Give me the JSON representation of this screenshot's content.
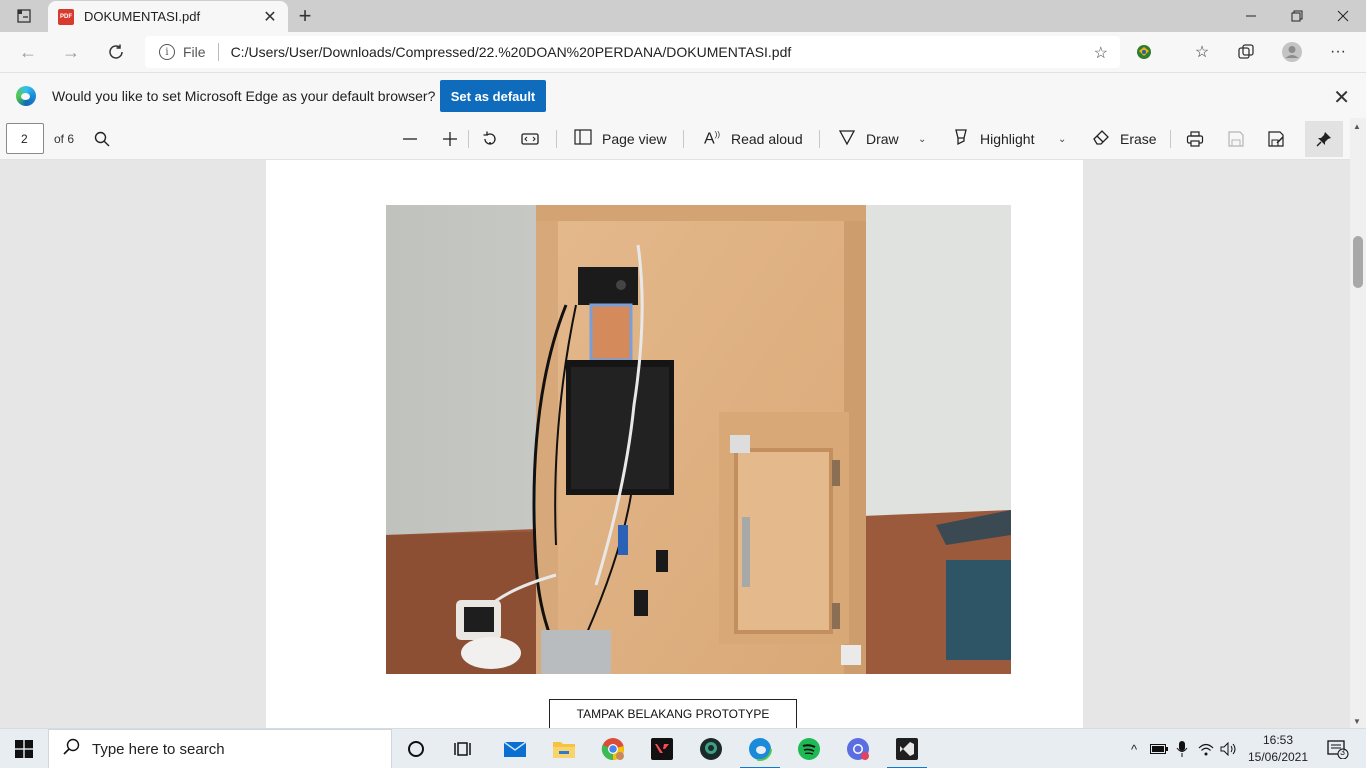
{
  "browser": {
    "tab": {
      "title": "DOKUMENTASI.pdf",
      "favicon": "PDF"
    },
    "address": {
      "scheme_label": "File",
      "url": "C:/Users/User/Downloads/Compressed/22.%20DOAN%20PERDANA/DOKUMENTASI.pdf"
    },
    "infobar": {
      "message": "Would you like to set Microsoft Edge as your default browser?",
      "button": "Set as default"
    }
  },
  "pdf_toolbar": {
    "page_number": "2",
    "page_count": "of 6",
    "page_view": "Page view",
    "read_aloud": "Read aloud",
    "draw": "Draw",
    "highlight": "Highlight",
    "erase": "Erase"
  },
  "document": {
    "caption": "TAMPAK BELAKANG PROTOTYPE"
  },
  "taskbar": {
    "search_placeholder": "Type here to search",
    "time": "16:53",
    "date": "15/06/2021",
    "notification_count": "3"
  },
  "colors": {
    "accent": "#0f6cbd",
    "tabstrip": "#cecece",
    "toolbar": "#f7f7f7",
    "viewer_bg": "#e6e6e6"
  }
}
